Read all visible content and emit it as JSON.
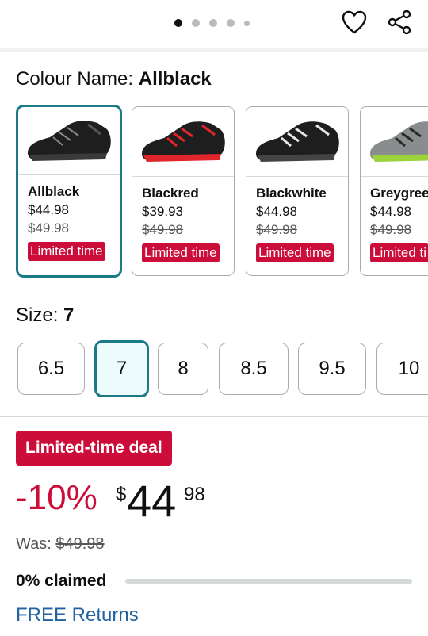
{
  "carousel": {
    "dots": 5,
    "active_index": 0
  },
  "colour": {
    "label": "Colour Name: ",
    "selected": "Allblack",
    "options": [
      {
        "name": "Allblack",
        "price": "$44.98",
        "was": "$49.98",
        "badge": "Limited time",
        "accent": "#333333"
      },
      {
        "name": "Blackred",
        "price": "$39.93",
        "was": "$49.98",
        "badge": "Limited time",
        "accent": "#e0262c"
      },
      {
        "name": "Blackwhite",
        "price": "$44.98",
        "was": "$49.98",
        "badge": "Limited time",
        "accent": "#e6e6e6"
      },
      {
        "name": "Greygree",
        "price": "$44.98",
        "was": "$49.98",
        "badge": "Limited ti",
        "accent": "#9bd33a"
      }
    ]
  },
  "size": {
    "label": "Size: ",
    "selected": "7",
    "options": [
      "6.5",
      "7",
      "8",
      "8.5",
      "9.5",
      "10"
    ]
  },
  "deal": {
    "badge": "Limited-time deal",
    "discount": "-10%",
    "currency": "$",
    "whole": "44",
    "fraction": "98",
    "was_label": "Was: ",
    "was_price": "$49.98",
    "claimed_text": "0% claimed",
    "claimed_fraction": 0,
    "free_returns": "FREE Returns"
  },
  "colors": {
    "teal": "#1b7a85",
    "deal_red": "#cc0c39",
    "link_blue": "#2162a1"
  }
}
